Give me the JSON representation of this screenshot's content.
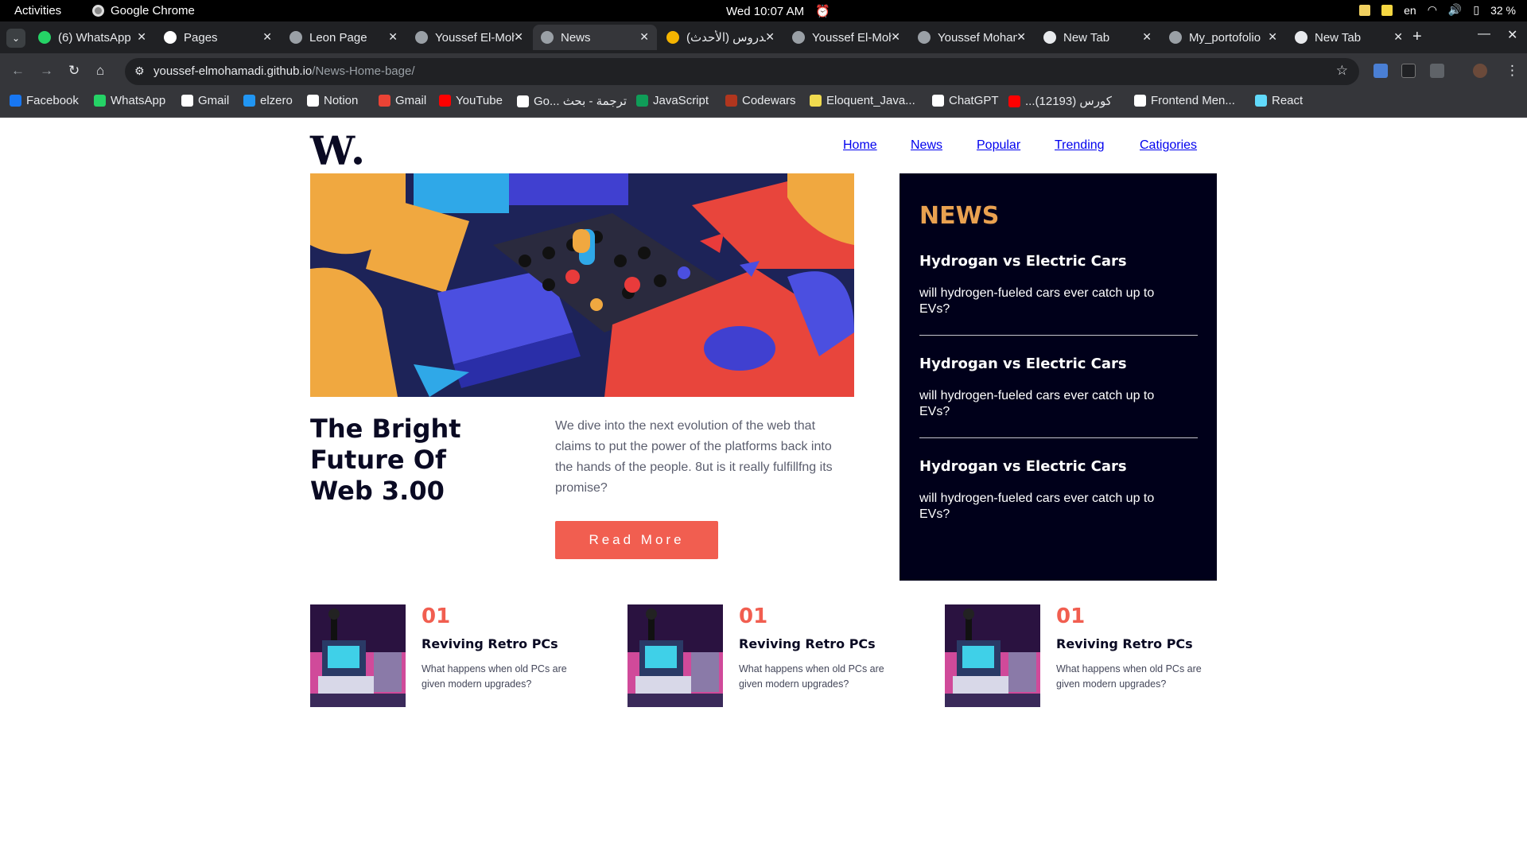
{
  "system_bar": {
    "activities": "Activities",
    "app_name": "Google Chrome",
    "clock": "Wed 10:07 AM",
    "language": "en",
    "battery": "32 %"
  },
  "tabs": [
    {
      "title": "(6) WhatsApp",
      "icon": "whatsapp-icon",
      "color": "#25d366"
    },
    {
      "title": "Pages",
      "icon": "github-icon",
      "color": "#ffffff"
    },
    {
      "title": "Leon Page",
      "icon": "globe-icon",
      "color": "#9aa0a6"
    },
    {
      "title": "Youssef El-Mohamadi",
      "icon": "globe-icon",
      "color": "#9aa0a6"
    },
    {
      "title": "News",
      "icon": "globe-icon",
      "color": "#9aa0a6",
      "active": true
    },
    {
      "title": "الدروس (الأحدث)",
      "icon": "notebook-icon",
      "color": "#f4b400"
    },
    {
      "title": "Youssef El-Mohamadi",
      "icon": "globe-icon",
      "color": "#9aa0a6"
    },
    {
      "title": "Youssef Mohamadi",
      "icon": "globe-icon",
      "color": "#9aa0a6"
    },
    {
      "title": "New Tab",
      "icon": "chrome-icon",
      "color": "#e8eaed"
    },
    {
      "title": "My_portofolio",
      "icon": "globe-icon",
      "color": "#9aa0a6"
    },
    {
      "title": "New Tab",
      "icon": "chrome-icon",
      "color": "#e8eaed"
    }
  ],
  "address_bar": {
    "host": "youssef-elmohamadi.github.io",
    "path": "/News-Home-bage/"
  },
  "bookmarks": [
    {
      "label": "Facebook",
      "color": "#1877f2"
    },
    {
      "label": "WhatsApp",
      "color": "#25d366"
    },
    {
      "label": "Gmail",
      "color": "#ffffff"
    },
    {
      "label": "elzero",
      "color": "#2196f3"
    },
    {
      "label": "Notion",
      "color": "#ffffff"
    },
    {
      "label": "Gmail",
      "color": "#ea4335"
    },
    {
      "label": "YouTube",
      "color": "#ff0000"
    },
    {
      "label": "Go... ترجمة - بحث",
      "color": "#ffffff"
    },
    {
      "label": "JavaScript",
      "color": "#0f9d58"
    },
    {
      "label": "Codewars",
      "color": "#b1361e"
    },
    {
      "label": "Eloquent_Java...",
      "color": "#f0db4f"
    },
    {
      "label": "ChatGPT",
      "color": "#ffffff"
    },
    {
      "label": "...كورس (12193)",
      "color": "#ff0000"
    },
    {
      "label": "Frontend Men...",
      "color": "#ffffff"
    },
    {
      "label": "React",
      "color": "#61dafb"
    }
  ],
  "site": {
    "logo": "W",
    "nav": [
      "Home",
      "News",
      "Popular",
      "Trending",
      "Catigories"
    ],
    "hero": {
      "title": "The Bright Future Of Web 3.00",
      "description": "We dive into the next evolution of the web that claims to put the power of the platforms back into the hands of the people. 8ut is it really fulfillfng its promise?",
      "button": "Read More"
    },
    "sidebar": {
      "heading": "NEWS",
      "items": [
        {
          "title": "Hydrogan vs Electric Cars",
          "text": "will hydrogen-fueled cars ever catch up to EVs?"
        },
        {
          "title": "Hydrogan vs Electric Cars",
          "text": "will hydrogen-fueled cars ever catch up to EVs?"
        },
        {
          "title": "Hydrogan vs Electric Cars",
          "text": "will hydrogen-fueled cars ever catch up to EVs?"
        }
      ]
    },
    "cards": [
      {
        "number": "01",
        "title": "Reviving Retro PCs",
        "text": "What happens when old PCs are given modern upgrades?"
      },
      {
        "number": "01",
        "title": "Reviving Retro PCs",
        "text": "What happens when old PCs are given modern upgrades?"
      },
      {
        "number": "01",
        "title": "Reviving Retro PCs",
        "text": "What happens when old PCs are given modern upgrades?"
      }
    ],
    "colors": {
      "accent": "#f15e50",
      "sidebar_bg": "#00001a",
      "sidebar_heading": "#e9a150",
      "nav_link": "#5a3f7a",
      "dark_text": "#0a0a23"
    }
  }
}
